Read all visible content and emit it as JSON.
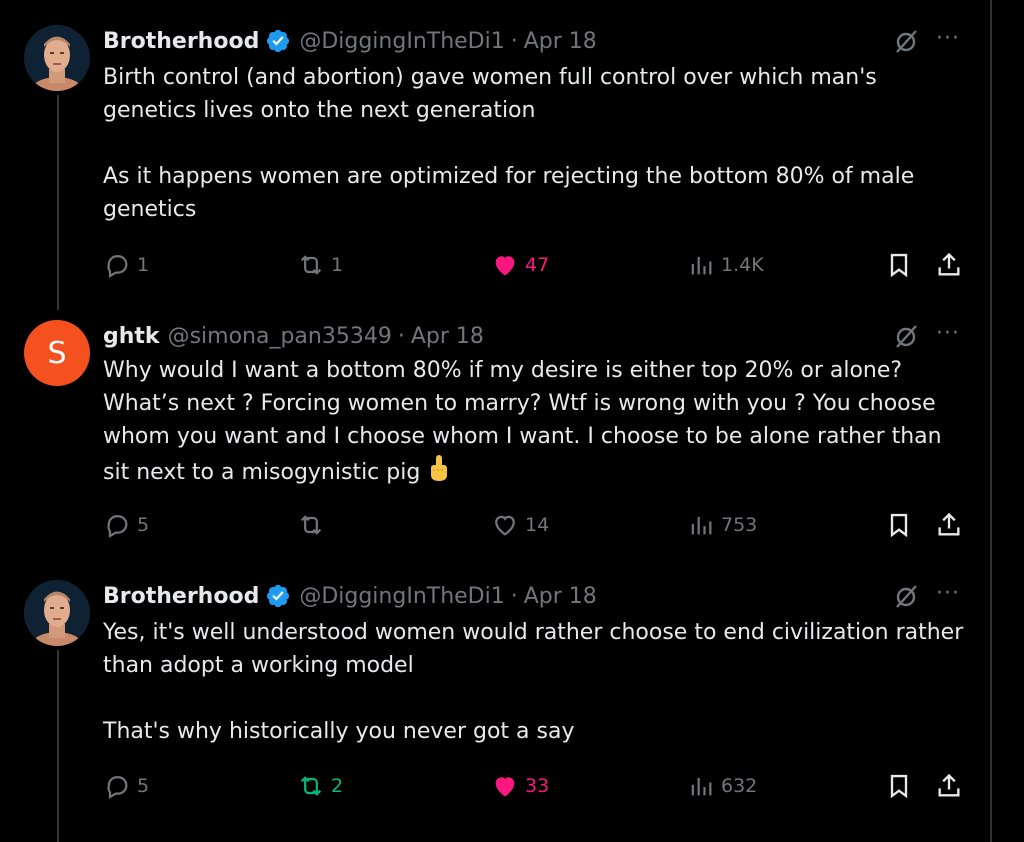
{
  "tweets": [
    {
      "name": "Brotherhood",
      "handle": "@DiggingInTheDi1",
      "date": "Apr 18",
      "paragraphs": [
        "Birth control (and abortion) gave women full control over which man's genetics lives onto the next generation",
        "As it happens women are optimized for rejecting the bottom 80% of male genetics"
      ],
      "replies": "1",
      "reposts": "1",
      "likes": "47",
      "views": "1.4K",
      "liked": true
    },
    {
      "name": "ghtk",
      "handle": "@simona_pan35349",
      "date": "Apr 18",
      "avatar_letter": "S",
      "paragraphs": [
        "Why would I want a bottom 80% if my desire is either top 20% or alone? What’s next ? Forcing women to marry? Wtf is wrong with you ? You choose whom you want and I choose whom I want. I choose to be alone rather than sit next to a misogynistic pig"
      ],
      "replies": "5",
      "reposts": "",
      "likes": "14",
      "views": "753"
    },
    {
      "name": "Brotherhood",
      "handle": "@DiggingInTheDi1",
      "date": "Apr 18",
      "paragraphs": [
        "Yes, it's well understood women would rather choose to end civilization rather than adopt a working model",
        "That's why historically you never got a say"
      ],
      "replies": "5",
      "reposts": "2",
      "likes": "33",
      "views": "632",
      "liked": true,
      "reposted": true
    }
  ],
  "sep": "·",
  "more": "···",
  "colors": {
    "background": "#000000",
    "text": "#e7e9ea",
    "muted": "#71767b",
    "like": "#f91880",
    "repost": "#00ba7c",
    "verified": "#1d9bf0",
    "avatar_letter_bg": "#f4511e"
  }
}
